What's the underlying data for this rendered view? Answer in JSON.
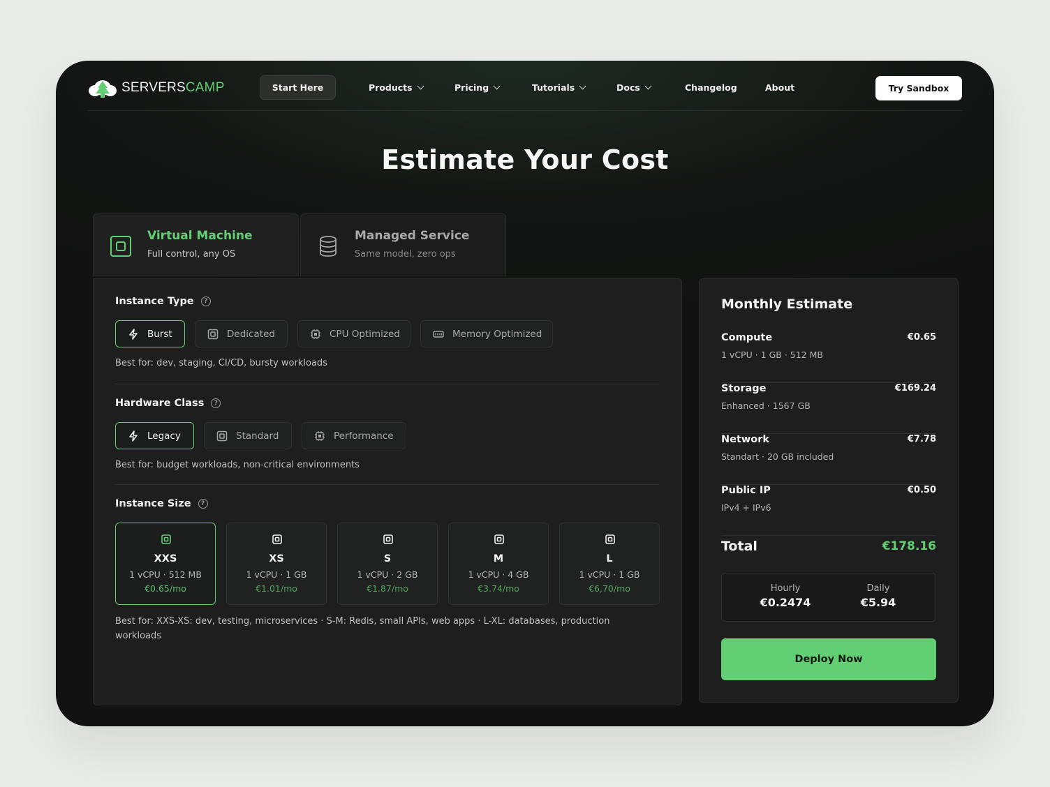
{
  "brand": {
    "part1": "SERVERS",
    "part2": "CAMP",
    "accent": "#63cf73"
  },
  "nav": {
    "start_label": "Start Here",
    "items": [
      {
        "label": "Products",
        "dropdown": true
      },
      {
        "label": "Pricing",
        "dropdown": true
      },
      {
        "label": "Tutorials",
        "dropdown": true
      },
      {
        "label": "Docs",
        "dropdown": true
      },
      {
        "label": "Changelog",
        "dropdown": false
      },
      {
        "label": "About",
        "dropdown": false
      }
    ],
    "sandbox_label": "Try Sandbox"
  },
  "page_title": "Estimate Your Cost",
  "tabs": [
    {
      "title": "Virtual Machine",
      "subtitle": "Full control, any OS",
      "icon": "chip-icon",
      "active": true
    },
    {
      "title": "Managed Service",
      "subtitle": "Same model, zero ops",
      "icon": "database-icon",
      "active": false
    }
  ],
  "instance_type": {
    "title": "Instance Type",
    "options": [
      {
        "label": "Burst",
        "icon": "bolt-icon",
        "selected": true
      },
      {
        "label": "Dedicated",
        "icon": "square-chip-icon",
        "selected": false
      },
      {
        "label": "CPU Optimized",
        "icon": "cpu-icon",
        "selected": false
      },
      {
        "label": "Memory Optimized",
        "icon": "memory-icon",
        "selected": false
      }
    ],
    "best_for": "Best for: dev, staging, CI/CD, bursty workloads"
  },
  "hardware_class": {
    "title": "Hardware Class",
    "options": [
      {
        "label": "Legacy",
        "icon": "bolt-icon",
        "selected": true
      },
      {
        "label": "Standard",
        "icon": "square-chip-icon",
        "selected": false
      },
      {
        "label": "Performance",
        "icon": "cpu-icon",
        "selected": false
      }
    ],
    "best_for": "Best for: budget workloads, non-critical environments"
  },
  "instance_size": {
    "title": "Instance Size",
    "options": [
      {
        "name": "XXS",
        "spec": "1 vCPU · 512 MB",
        "price": "€0.65/mo",
        "selected": true
      },
      {
        "name": "XS",
        "spec": "1 vCPU · 1 GB",
        "price": "€1.01/mo",
        "selected": false
      },
      {
        "name": "S",
        "spec": "1 vCPU · 2 GB",
        "price": "€1.87/mo",
        "selected": false
      },
      {
        "name": "M",
        "spec": "1 vCPU · 4 GB",
        "price": "€3.74/mo",
        "selected": false
      },
      {
        "name": "L",
        "spec": "1 vCPU · 1 GB",
        "price": "€6,70/mo",
        "selected": false
      }
    ],
    "best_for": "Best for: XXS-XS: dev, testing, microservices · S-M: Redis, small APIs, web apps · L-XL: databases, production workloads"
  },
  "estimate": {
    "title": "Monthly Estimate",
    "rows": [
      {
        "label": "Compute",
        "sub": "1 vCPU · 1 GB · 512 MB",
        "value": "€0.65"
      },
      {
        "label": "Storage",
        "sub": "Enhanced · 1567 GB",
        "value": "€169.24"
      },
      {
        "label": "Network",
        "sub": "Standart · 20 GB included",
        "value": "€7.78"
      },
      {
        "label": "Public IP",
        "sub": "IPv4 + IPv6",
        "value": "€0.50"
      }
    ],
    "total_label": "Total",
    "total_value": "€178.16",
    "hourly_label": "Hourly",
    "hourly_value": "€0.2474",
    "daily_label": "Daily",
    "daily_value": "€5.94",
    "deploy_label": "Deploy Now"
  }
}
